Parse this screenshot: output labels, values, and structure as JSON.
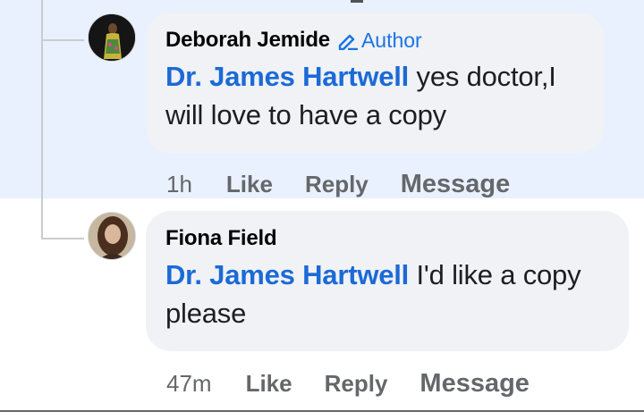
{
  "comments": [
    {
      "author": "Deborah Jemide",
      "badge": "Author",
      "mention": "Dr. James Hartwell",
      "text": " yes doctor,I will love to have a copy",
      "time": "1h",
      "like": "Like",
      "reply": "Reply",
      "message": "Message"
    },
    {
      "author": "Fiona Field",
      "mention": "Dr. James Hartwell",
      "text": " I'd like a copy please",
      "time": "47m",
      "like": "Like",
      "reply": "Reply",
      "message": "Message"
    }
  ],
  "colors": {
    "highlight": "#e8f1fd",
    "mention": "#1b6ad6",
    "badge": "#1b74e4",
    "bubble": "#f0f2f5"
  }
}
